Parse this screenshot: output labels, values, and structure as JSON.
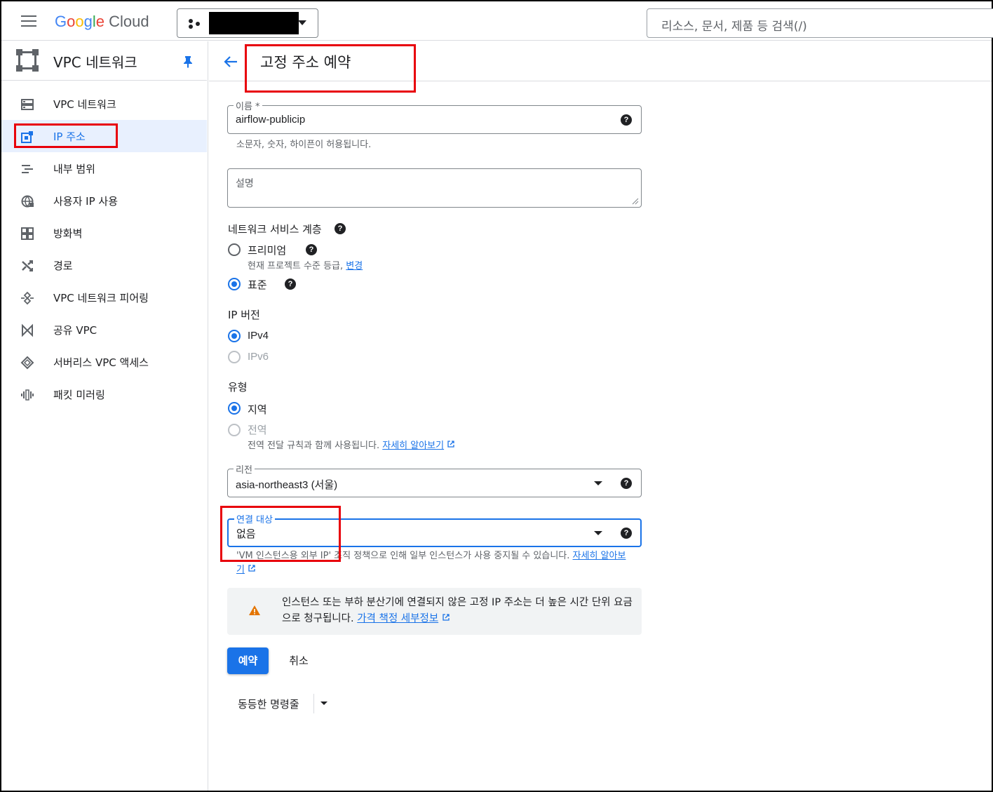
{
  "header": {
    "logo_google": "Google",
    "logo_cloud": "Cloud",
    "search_placeholder": "리소스, 문서, 제품 등 검색(/)"
  },
  "sidebar": {
    "title": "VPC 네트워크",
    "items": [
      {
        "label": "VPC 네트워크",
        "icon": "vpc-network-icon"
      },
      {
        "label": "IP 주소",
        "icon": "ip-address-icon",
        "active": true
      },
      {
        "label": "내부 범위",
        "icon": "internal-range-icon"
      },
      {
        "label": "사용자 IP 사용",
        "icon": "byoip-icon"
      },
      {
        "label": "방화벽",
        "icon": "firewall-icon"
      },
      {
        "label": "경로",
        "icon": "routes-icon"
      },
      {
        "label": "VPC 네트워크 피어링",
        "icon": "peering-icon"
      },
      {
        "label": "공유 VPC",
        "icon": "shared-vpc-icon"
      },
      {
        "label": "서버리스 VPC 액세스",
        "icon": "serverless-icon"
      },
      {
        "label": "패킷 미러링",
        "icon": "packet-mirroring-icon"
      }
    ]
  },
  "page": {
    "title": "고정 주소 예약"
  },
  "form": {
    "name": {
      "label": "이름 *",
      "value": "airflow-publicip",
      "hint": "소문자, 숫자, 하이픈이 허용됩니다."
    },
    "description": {
      "placeholder": "설명"
    },
    "tier": {
      "label": "네트워크 서비스 계층",
      "premium": "프리미엄",
      "premium_hint": "현재 프로젝트 수준 등급,",
      "premium_link": "변경",
      "standard": "표준",
      "selected": "표준"
    },
    "ip_version": {
      "label": "IP 버전",
      "ipv4": "IPv4",
      "ipv6": "IPv6",
      "selected": "IPv4"
    },
    "type": {
      "label": "유형",
      "regional": "지역",
      "global": "전역",
      "global_hint": "전역 전달 규칙과 함께 사용됩니다.",
      "global_link": "자세히 알아보기",
      "selected": "지역"
    },
    "region": {
      "label": "리전",
      "value": "asia-northeast3 (서울)"
    },
    "attached_to": {
      "label": "연결 대상",
      "value": "없음",
      "hint": "'VM 인스턴스용 외부 IP' 조직 정책으로 인해 일부 인스턴스가 사용 중지될 수 있습니다.",
      "link_part1": "자",
      "link_part2": "세히 알아보기"
    },
    "warning": {
      "text": "인스턴스 또는 부하 분산기에 연결되지 않은 고정 IP 주소는 더 높은 시간 단위 요금으로 청구됩니다.",
      "link": "가격 책정 세부정보"
    }
  },
  "actions": {
    "reserve": "예약",
    "cancel": "취소",
    "command_line": "동등한 명령줄"
  },
  "colors": {
    "accent": "#1a73e8",
    "highlight_box": "#e8000b",
    "warning": "#e37400"
  }
}
